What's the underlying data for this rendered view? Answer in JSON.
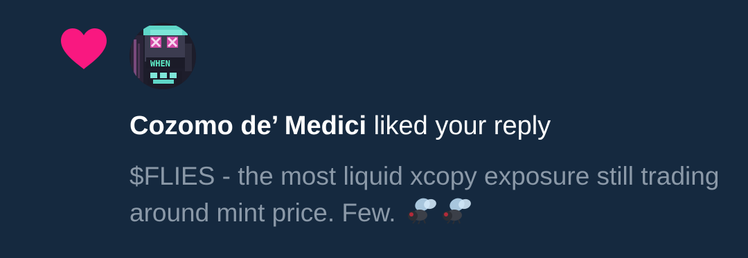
{
  "notification": {
    "icon": "heart-icon",
    "heart_color": "#f91880",
    "background_color": "#15293f",
    "avatar": {
      "text": "WHEN",
      "description_icon": "pixel-art-avatar-icon"
    },
    "user_name": "Cozomo de’ Medici",
    "action_text": " liked your reply",
    "reply_text": "$FLIES - the most liquid xcopy exposure still trading around mint price. Few.",
    "emojis": [
      "fly-emoji-icon",
      "fly-emoji-icon"
    ]
  }
}
